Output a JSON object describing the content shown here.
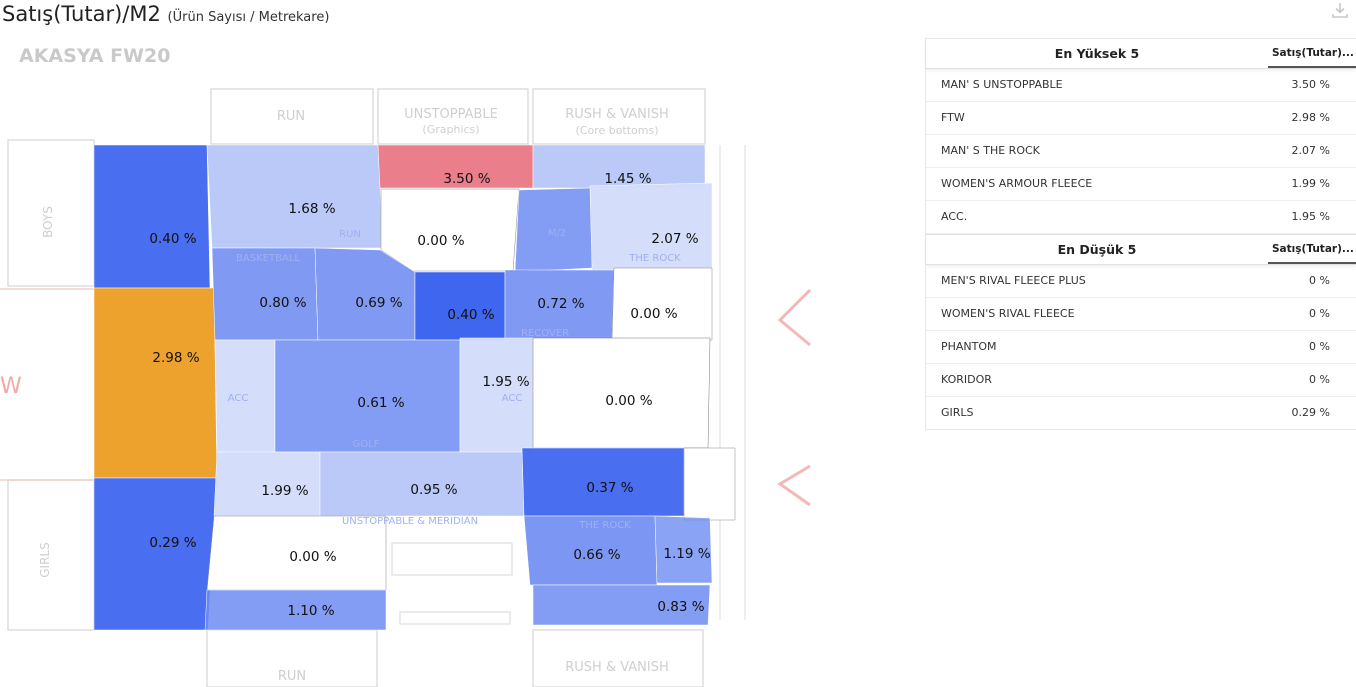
{
  "title": "Satış(Tutar)/M2",
  "subtitle": "(Ürün Sayısı / Metrekare)",
  "store_name": "AKASYA FW20",
  "icons": {
    "download": "download-icon"
  },
  "colors": {
    "high": "#e8707d",
    "orange": "#eda22d",
    "blue_strong": "#3f66ee",
    "blue_mid": "#6e8cf2",
    "blue_light": "#aebff7",
    "blue_pale": "#d2dcfa"
  },
  "floor_labels": {
    "run_top": "RUN",
    "unstoppable": "UNSTOPPABLE",
    "graphics": "(Graphics)",
    "rush_top": "RUSH & VANISH",
    "core_bottoms": "(Core bottoms)",
    "boys": "BOYS",
    "girls": "GIRLS",
    "run_bottom": "RUN",
    "rush_bottom": "RUSH & VANISH"
  },
  "zones": [
    {
      "id": "boys",
      "value": "0.40 %"
    },
    {
      "id": "ftw",
      "value": "2.98 %"
    },
    {
      "id": "girls",
      "value": "0.29 %"
    },
    {
      "id": "run-upper",
      "value": "1.68 %"
    },
    {
      "id": "unstoppable",
      "value": "3.50 %"
    },
    {
      "id": "rival-fleece-plus",
      "value": "0.00 %"
    },
    {
      "id": "rush-strip",
      "value": "1.45 %"
    },
    {
      "id": "the-rock",
      "value": "2.07 %"
    },
    {
      "id": "basketball",
      "value": "0.80 %"
    },
    {
      "id": "armour-fleece",
      "value": "0.69 %"
    },
    {
      "id": "center-small",
      "value": "0.40 %"
    },
    {
      "id": "recover",
      "value": "0.72 %"
    },
    {
      "id": "white-right-1",
      "value": "0.00 %"
    },
    {
      "id": "golf",
      "value": "0.61 %"
    },
    {
      "id": "acc",
      "value": "1.95 %"
    },
    {
      "id": "phantom",
      "value": "0.00 %"
    },
    {
      "id": "armour-lower",
      "value": "1.99 %"
    },
    {
      "id": "unstoppable-meridian",
      "value": "0.95 %"
    },
    {
      "id": "recover-lower",
      "value": "0.37 %"
    },
    {
      "id": "rival-fleece-graphics",
      "value": "0.00 %"
    },
    {
      "id": "the-rock-lower",
      "value": "0.66 %"
    },
    {
      "id": "right-small",
      "value": "1.19 %"
    },
    {
      "id": "run-lower",
      "value": "1.10 %"
    },
    {
      "id": "rush-lower",
      "value": "0.83 %"
    }
  ],
  "top5": {
    "header": "En Yüksek 5",
    "column": "Satış(Tutar)...",
    "rows": [
      {
        "name": "MAN' S UNSTOPPABLE",
        "value": "3.50 %"
      },
      {
        "name": "FTW",
        "value": "2.98 %"
      },
      {
        "name": "MAN' S THE ROCK",
        "value": "2.07 %"
      },
      {
        "name": "WOMEN'S ARMOUR FLEECE",
        "value": "1.99 %"
      },
      {
        "name": "ACC.",
        "value": "1.95 %"
      }
    ]
  },
  "bottom5": {
    "header": "En Düşük 5",
    "column": "Satış(Tutar)...",
    "rows": [
      {
        "name": "MEN'S RIVAL FLEECE PLUS",
        "value": "0 %"
      },
      {
        "name": "WOMEN'S RIVAL FLEECE",
        "value": "0 %"
      },
      {
        "name": "PHANTOM",
        "value": "0 %"
      },
      {
        "name": "KORIDOR",
        "value": "0 %"
      },
      {
        "name": "GIRLS",
        "value": "0.29 %"
      }
    ]
  }
}
